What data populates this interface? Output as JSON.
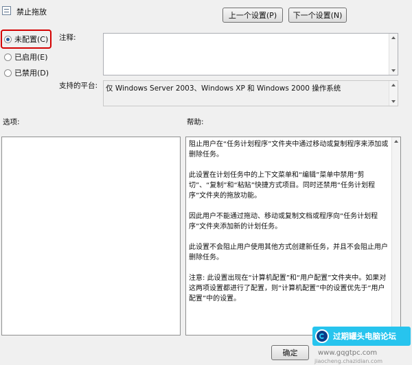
{
  "window": {
    "title": "禁止拖放"
  },
  "nav": {
    "prev_label": "上一个设置(P)",
    "next_label": "下一个设置(N)"
  },
  "state_options": [
    {
      "label": "未配置(C)",
      "checked": true
    },
    {
      "label": "已启用(E)",
      "checked": false
    },
    {
      "label": "已禁用(D)",
      "checked": false
    }
  ],
  "comment": {
    "label": "注释:",
    "value": ""
  },
  "platform": {
    "label": "支持的平台:",
    "value": "仅 Windows Server 2003、Windows XP 和 Windows 2000 操作系统"
  },
  "options": {
    "label": "选项:"
  },
  "help": {
    "label": "帮助:",
    "paragraphs": [
      "阻止用户在“任务计划程序”文件夹中通过移动或复制程序来添加或删除任务。",
      "此设置在计划任务中的上下文菜单和“编辑”菜单中禁用“剪切”、“复制”和“粘贴”快捷方式项目。同时还禁用“任务计划程序”文件夹的拖放功能。",
      "因此用户不能通过拖动、移动或复制文档或程序向“任务计划程序”文件夹添加新的计划任务。",
      "此设置不会阻止用户使用其他方式创建新任务，并且不会阻止用户删除任务。",
      "注意: 此设置出现在“计算机配置”和“用户配置”文件夹中。如果对这两项设置都进行了配置，则“计算机配置”中的设置优先于“用户配置”中的设置。"
    ]
  },
  "footer": {
    "ok_label": "确定"
  },
  "watermark": {
    "text": "过期罐头电脑论坛",
    "url": "www.gqgtpc.com",
    "url2": "jiaocheng.chazidian.com"
  }
}
